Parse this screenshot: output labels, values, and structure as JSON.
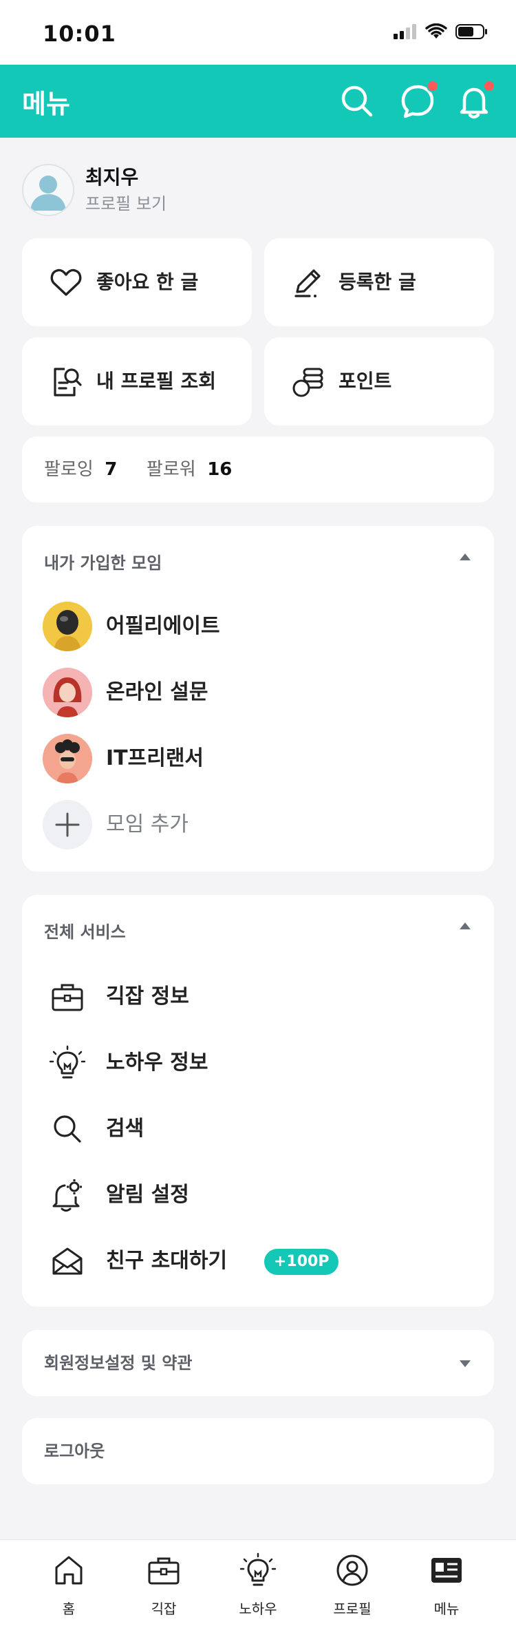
{
  "status_bar": {
    "time": "10:01"
  },
  "header": {
    "title": "메뉴"
  },
  "profile": {
    "name": "최지우",
    "link": "프로필 보기"
  },
  "tiles": [
    {
      "label": "좋아요 한 글",
      "icon": "heart-icon"
    },
    {
      "label": "등록한 글",
      "icon": "pencil-icon"
    },
    {
      "label": "내 프로필 조회",
      "icon": "profile-search-icon"
    },
    {
      "label": "포인트",
      "icon": "coins-icon"
    }
  ],
  "follow": {
    "following_label": "팔로잉",
    "following_count": "7",
    "followers_label": "팔로워",
    "followers_count": "16"
  },
  "groups": {
    "title": "내가 가입한 모임",
    "items": [
      {
        "label": "어필리에이트",
        "avatar": "gold-astronaut"
      },
      {
        "label": "온라인 설문",
        "avatar": "red-hair-character"
      },
      {
        "label": "IT프리랜서",
        "avatar": "curly-hair-character"
      }
    ],
    "add_label": "모임 추가"
  },
  "services": {
    "title": "전체 서비스",
    "items": [
      {
        "label": "긱잡 정보",
        "icon": "briefcase-icon"
      },
      {
        "label": "노하우 정보",
        "icon": "lightbulb-icon"
      },
      {
        "label": "검색",
        "icon": "search-icon"
      },
      {
        "label": "알림 설정",
        "icon": "bell-gear-icon"
      },
      {
        "label": "친구 초대하기",
        "icon": "envelope-icon",
        "badge": "+100P"
      }
    ]
  },
  "settings": {
    "label": "회원정보설정 및 약관"
  },
  "logout": {
    "label": "로그아웃"
  },
  "tabs": [
    {
      "label": "홈",
      "icon": "home-icon"
    },
    {
      "label": "긱잡",
      "icon": "briefcase-icon"
    },
    {
      "label": "노하우",
      "icon": "lightbulb-icon"
    },
    {
      "label": "프로필",
      "icon": "profile-icon"
    },
    {
      "label": "메뉴",
      "icon": "menu-icon"
    }
  ],
  "colors": {
    "accent": "#13c8b7",
    "notification_dot": "#ff5a5a",
    "background": "#f4f4f6"
  }
}
